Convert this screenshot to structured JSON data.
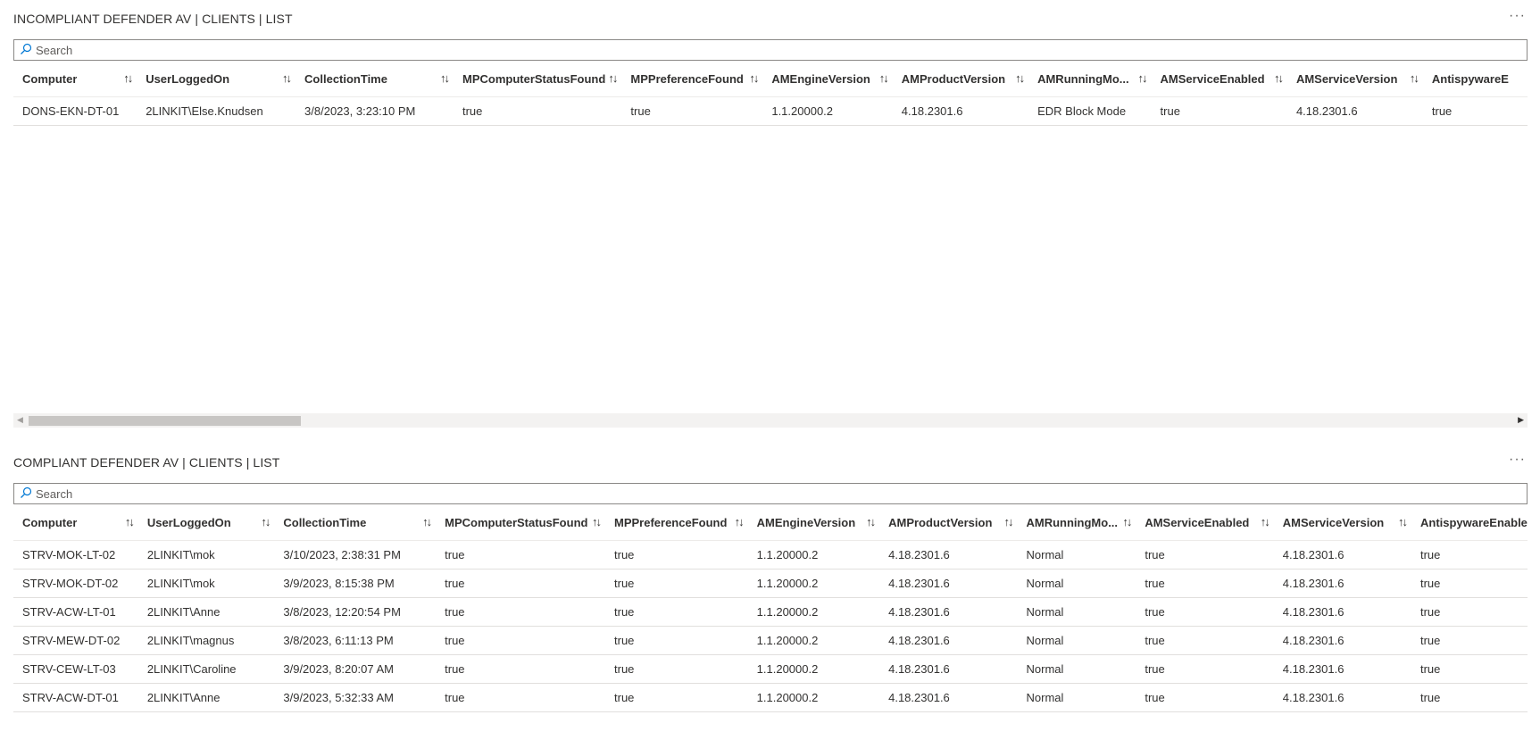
{
  "icons": {
    "search": "search-icon",
    "more": "more-icon",
    "sort": "sort-icon",
    "scroll_left": "chevron-left-icon",
    "scroll_right": "chevron-right-icon"
  },
  "sort_glyph": "↑↓",
  "more_glyph": "···",
  "incompliant": {
    "title": "INCOMPLIANT DEFENDER AV | CLIENTS | LIST",
    "search_placeholder": "Search",
    "columns": [
      "Computer",
      "UserLoggedOn",
      "CollectionTime",
      "MPComputerStatusFound",
      "MPPreferenceFound",
      "AMEngineVersion",
      "AMProductVersion",
      "AMRunningMo...",
      "AMServiceEnabled",
      "AMServiceVersion",
      "AntispywareE"
    ],
    "rows": [
      [
        "DONS-EKN-DT-01",
        "2LINKIT\\Else.Knudsen",
        "3/8/2023, 3:23:10 PM",
        "true",
        "true",
        "1.1.20000.2",
        "4.18.2301.6",
        "EDR Block Mode",
        "true",
        "4.18.2301.6",
        "true"
      ]
    ]
  },
  "compliant": {
    "title": "COMPLIANT DEFENDER AV | CLIENTS | LIST",
    "search_placeholder": "Search",
    "columns": [
      "Computer",
      "UserLoggedOn",
      "CollectionTime",
      "MPComputerStatusFound",
      "MPPreferenceFound",
      "AMEngineVersion",
      "AMProductVersion",
      "AMRunningMo...",
      "AMServiceEnabled",
      "AMServiceVersion",
      "AntispywareEnable"
    ],
    "rows": [
      [
        "STRV-MOK-LT-02",
        "2LINKIT\\mok",
        "3/10/2023, 2:38:31 PM",
        "true",
        "true",
        "1.1.20000.2",
        "4.18.2301.6",
        "Normal",
        "true",
        "4.18.2301.6",
        "true"
      ],
      [
        "STRV-MOK-DT-02",
        "2LINKIT\\mok",
        "3/9/2023, 8:15:38 PM",
        "true",
        "true",
        "1.1.20000.2",
        "4.18.2301.6",
        "Normal",
        "true",
        "4.18.2301.6",
        "true"
      ],
      [
        "STRV-ACW-LT-01",
        "2LINKIT\\Anne",
        "3/8/2023, 12:20:54 PM",
        "true",
        "true",
        "1.1.20000.2",
        "4.18.2301.6",
        "Normal",
        "true",
        "4.18.2301.6",
        "true"
      ],
      [
        "STRV-MEW-DT-02",
        "2LINKIT\\magnus",
        "3/8/2023, 6:11:13 PM",
        "true",
        "true",
        "1.1.20000.2",
        "4.18.2301.6",
        "Normal",
        "true",
        "4.18.2301.6",
        "true"
      ],
      [
        "STRV-CEW-LT-03",
        "2LINKIT\\Caroline",
        "3/9/2023, 8:20:07 AM",
        "true",
        "true",
        "1.1.20000.2",
        "4.18.2301.6",
        "Normal",
        "true",
        "4.18.2301.6",
        "true"
      ],
      [
        "STRV-ACW-DT-01",
        "2LINKIT\\Anne",
        "3/9/2023, 5:32:33 AM",
        "true",
        "true",
        "1.1.20000.2",
        "4.18.2301.6",
        "Normal",
        "true",
        "4.18.2301.6",
        "true"
      ]
    ]
  }
}
